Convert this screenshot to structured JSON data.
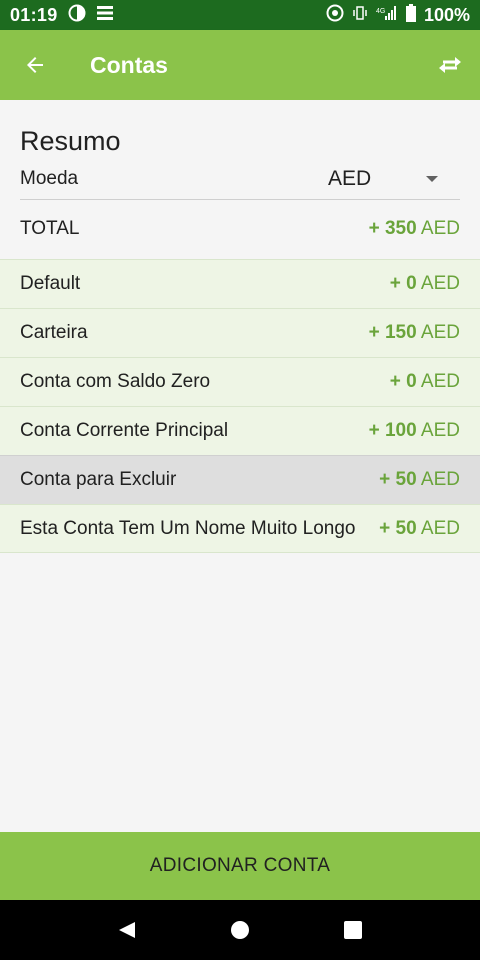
{
  "status_bar": {
    "time": "01:19",
    "battery": "100%",
    "network": "4G"
  },
  "app_bar": {
    "title": "Contas",
    "back_icon": "arrow-left-icon",
    "swap_icon": "swap-horizontal-icon"
  },
  "summary": {
    "heading": "Resumo",
    "currency_label": "Moeda",
    "currency_value": "AED",
    "total_label": "TOTAL",
    "total_amount": "+ 350",
    "total_currency": "AED"
  },
  "accounts": [
    {
      "name": "Default",
      "amount": "+ 0",
      "currency": "AED"
    },
    {
      "name": "Carteira",
      "amount": "+ 150",
      "currency": "AED"
    },
    {
      "name": "Conta com Saldo Zero",
      "amount": "+ 0",
      "currency": "AED"
    },
    {
      "name": "Conta Corrente Principal",
      "amount": "+ 100",
      "currency": "AED"
    },
    {
      "name": "Conta para Excluir",
      "amount": "+ 50",
      "currency": "AED"
    },
    {
      "name": "Esta Conta Tem Um Nome Muito Longo",
      "amount": "+ 50",
      "currency": "AED"
    }
  ],
  "add_button": "ADICIONAR CONTA",
  "colors": {
    "status_bar": "#1d6b1f",
    "app_bar": "#8bc34a",
    "amount": "#6aa43b",
    "row_bg": "#eef5e5",
    "row_selected": "#dedede"
  }
}
